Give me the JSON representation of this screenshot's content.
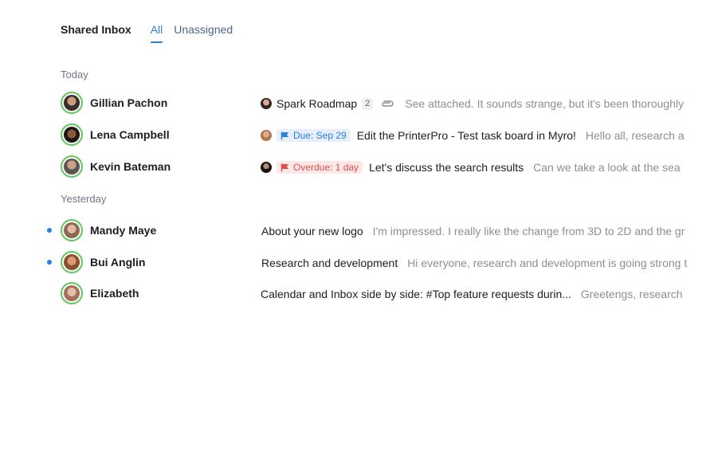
{
  "header": {
    "title": "Shared Inbox",
    "tabs": [
      {
        "label": "All",
        "active": true
      },
      {
        "label": "Unassigned",
        "active": false
      }
    ]
  },
  "sections": [
    {
      "label": "Today",
      "rows": [
        {
          "sender": "Gillian Pachon",
          "unread": false,
          "subject": "Spark Roadmap",
          "thread_count": "2",
          "attachment_icon": "paperclip-icon",
          "preview": "See attached. It sounds strange, but it's been thoroughly"
        },
        {
          "sender": "Lena Campbell",
          "unread": false,
          "badge": {
            "type": "due",
            "label": "Due: Sep 29",
            "icon": "flag-icon"
          },
          "subject": "Edit the PrinterPro - Test task board in Myro!",
          "preview": "Hello all, research a"
        },
        {
          "sender": "Kevin Bateman",
          "unread": false,
          "badge": {
            "type": "overdue",
            "label": "Overdue: 1 day",
            "icon": "flag-icon"
          },
          "subject": "Let's discuss the search results",
          "preview": "Can we take a look at the sea"
        }
      ]
    },
    {
      "label": "Yesterday",
      "rows": [
        {
          "sender": "Mandy Maye",
          "unread": true,
          "subject": "About your new logo",
          "preview": "I'm impressed. I really like the change from 3D to 2D and the gr"
        },
        {
          "sender": "Bui Anglin",
          "unread": true,
          "subject": "Research and development",
          "preview": "Hi everyone, research and development is going strong t"
        },
        {
          "sender": "Elizabeth",
          "unread": false,
          "subject": "Calendar and Inbox side by side: #Top feature requests durin...",
          "preview": "Greetengs, research"
        }
      ]
    }
  ],
  "colors": {
    "accent": "#2a7de1",
    "avatar_ring": "#5fc85a",
    "due_badge": "#2a7de1",
    "overdue_badge": "#e04e4e",
    "unread_dot": "#2a7de1"
  }
}
